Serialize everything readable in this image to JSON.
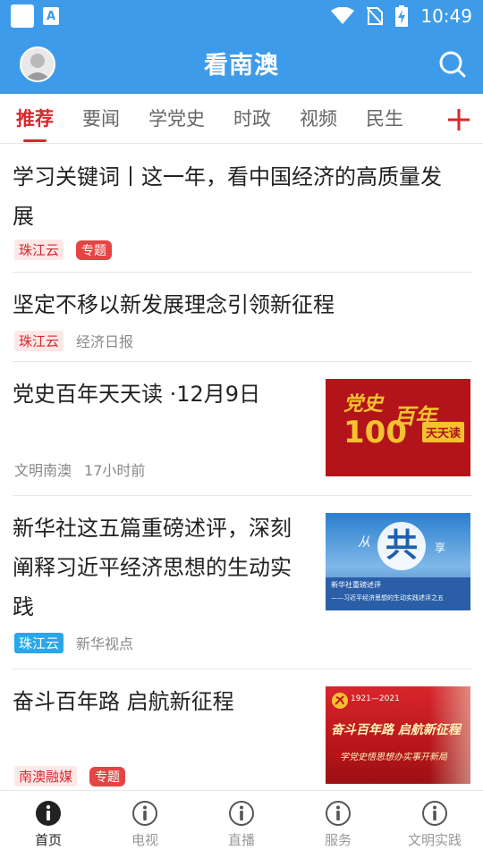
{
  "status_bar": {
    "time": "10:49"
  },
  "header": {
    "title": "看南澳"
  },
  "tabs": [
    {
      "label": "推荐",
      "active": true
    },
    {
      "label": "要闻"
    },
    {
      "label": "学党史"
    },
    {
      "label": "时政"
    },
    {
      "label": "视频"
    },
    {
      "label": "民生"
    }
  ],
  "articles": [
    {
      "title": "学习关键词丨这一年，看中国经济的高质量发展",
      "source": "珠江云",
      "topic": "专题"
    },
    {
      "title": "坚定不移以新发展理念引领新征程",
      "source": "珠江云",
      "publisher": "经济日报"
    },
    {
      "title": "党史百年天天读 ·12月9日",
      "source": "文明南澳",
      "time": "17小时前",
      "thumb": {
        "line1": "党史",
        "num": "100",
        "line2": "百年",
        "badge": "天天读"
      }
    },
    {
      "title": "新华社这五篇重磅述评，深刻阐释习近平经济思想的生动实践",
      "source": "珠江云",
      "publisher": "新华视点",
      "thumb": {
        "big": "共",
        "small_left": "从",
        "small_right": "享",
        "caption1": "新华社重磅述评",
        "caption2": "——习近平经济思想的生动实践述评之五"
      }
    },
    {
      "title": "奋斗百年路 启航新征程",
      "source": "南澳融媒",
      "topic": "专题",
      "thumb": {
        "years": "1921—2021",
        "slogan": "奋斗百年路 启航新征程",
        "sub": "学党史悟思想办实事开新局"
      }
    }
  ],
  "bottom_nav": [
    {
      "label": "首页",
      "active": true
    },
    {
      "label": "电视"
    },
    {
      "label": "直播"
    },
    {
      "label": "服务"
    },
    {
      "label": "文明实践"
    }
  ],
  "colors": {
    "brand_blue": "#3d9be9",
    "accent_red": "#d8282d"
  }
}
